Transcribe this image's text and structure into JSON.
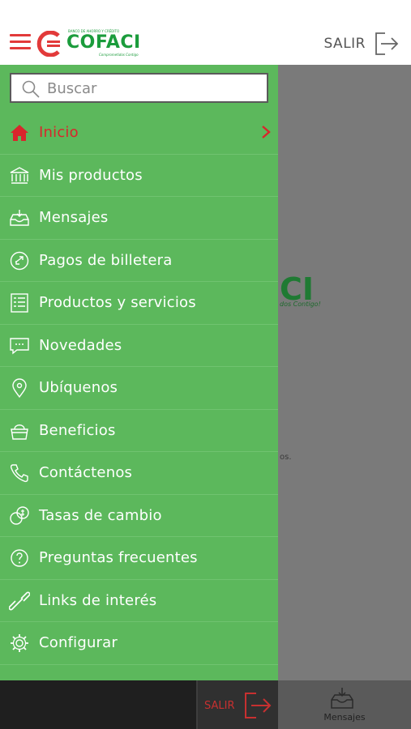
{
  "header": {
    "brand": "COFACI",
    "brand_subtitle": "BANCO DE AHORRO Y CRÉDITO",
    "brand_tagline": "Comprometidos Contigo",
    "logout_label": "SALIR"
  },
  "background": {
    "brand_fragment": "CI",
    "tagline_fragment": "dos Contigo!",
    "text_fragment": "os."
  },
  "drawer": {
    "search": {
      "placeholder": "Buscar",
      "value": ""
    },
    "items": [
      {
        "label": "Inicio",
        "icon": "home-icon",
        "active": true
      },
      {
        "label": "Mis productos",
        "icon": "bank-icon"
      },
      {
        "label": "Mensajes",
        "icon": "inbox-icon"
      },
      {
        "label": "Pagos de billetera",
        "icon": "transfer-icon"
      },
      {
        "label": "Productos y servicios",
        "icon": "list-icon"
      },
      {
        "label": "Novedades",
        "icon": "chat-icon"
      },
      {
        "label": "Ubíquenos",
        "icon": "location-pin-icon"
      },
      {
        "label": "Beneficios",
        "icon": "basket-icon"
      },
      {
        "label": "Contáctenos",
        "icon": "phone-icon"
      },
      {
        "label": "Tasas de cambio",
        "icon": "currency-icon"
      },
      {
        "label": "Preguntas frecuentes",
        "icon": "question-icon"
      },
      {
        "label": "Links de interés",
        "icon": "link-icon"
      },
      {
        "label": "Configurar",
        "icon": "gear-icon"
      }
    ]
  },
  "bottom_bar": {
    "logout_label": "SALIR",
    "messages_label": "Mensajes"
  },
  "colors": {
    "drawer_green": "#5cb85c",
    "accent_red": "#d9262c",
    "brand_green": "#1b9c3c"
  }
}
